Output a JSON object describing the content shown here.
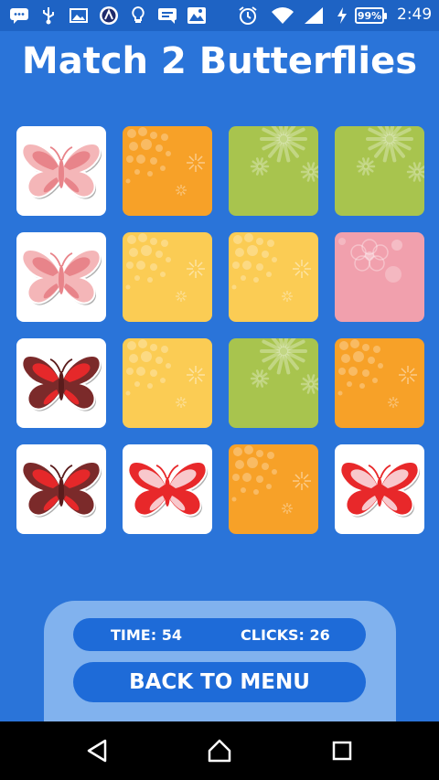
{
  "status_bar": {
    "battery": "99%",
    "time": "2:49"
  },
  "game": {
    "title": "Match 2 Butterflies",
    "board": [
      [
        "butterfly-pink",
        "back-orange",
        "back-green",
        "back-green"
      ],
      [
        "butterfly-pink",
        "back-yellow",
        "back-yellow",
        "back-pink"
      ],
      [
        "butterfly-maroon",
        "back-yellow",
        "back-green",
        "back-orange"
      ],
      [
        "butterfly-maroon",
        "butterfly-red",
        "back-orange",
        "butterfly-red"
      ]
    ],
    "colors": {
      "background": "#2a74d9",
      "back-orange": "#f7a128",
      "back-green": "#a8c44e",
      "back-yellow": "#fbcc54",
      "back-pink": "#f1a0ad",
      "butterfly-pink": "#f4b6b8",
      "butterfly-maroon": "#7b2a2a",
      "butterfly-red": "#e8282a"
    }
  },
  "stats": {
    "time_label": "TIME: 54",
    "clicks_label": "CLICKS: 26"
  },
  "menu": {
    "back_label": "BACK TO MENU"
  }
}
